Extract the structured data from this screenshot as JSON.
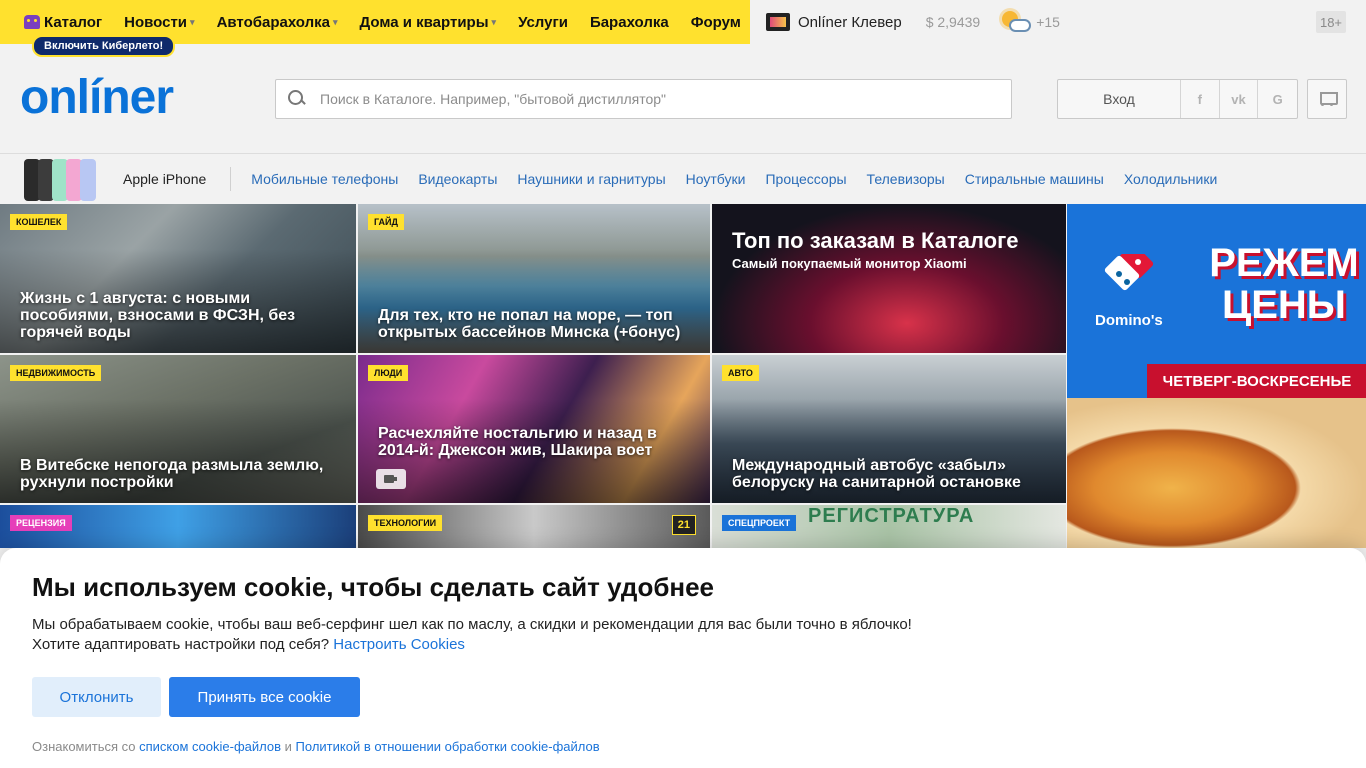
{
  "topnav": {
    "items": [
      {
        "label": "Каталог",
        "dropdown": false,
        "icon": "cyberleto-icon"
      },
      {
        "label": "Новости",
        "dropdown": true
      },
      {
        "label": "Автобарахолка",
        "dropdown": true
      },
      {
        "label": "Дома и квартиры",
        "dropdown": true
      },
      {
        "label": "Услуги",
        "dropdown": false
      },
      {
        "label": "Барахолка",
        "dropdown": false
      },
      {
        "label": "Форум",
        "dropdown": false
      }
    ],
    "cyber_button": "Включить Киберлето!",
    "accent_color": "#ffe12e"
  },
  "topright": {
    "klever": "Onlíner Клевер",
    "currency": "$ 2,9439",
    "temperature": "+15",
    "age_rating": "18+"
  },
  "header": {
    "logo": "onlíner",
    "search_placeholder": "Поиск в Каталоге. Например, \"бытовой дистиллятор\"",
    "search_value": "",
    "login": "Вход",
    "social": [
      "f",
      "vk",
      "G"
    ]
  },
  "catalog_strip": {
    "featured": "Apple iPhone",
    "links": [
      "Мобильные телефоны",
      "Видеокарты",
      "Наушники и гарнитуры",
      "Ноутбуки",
      "Процессоры",
      "Телевизоры",
      "Стиральные машины",
      "Холодильники"
    ]
  },
  "news": [
    {
      "tag": "Кошелек",
      "title": "Жизнь с 1 августа: с новыми пособиями, взносами в ФСЗН, без горячей воды"
    },
    {
      "tag": "Гайд",
      "title": "Для тех, кто не попал на море, — топ открытых бассейнов Минска (+бонус)"
    },
    {
      "promo_title": "Топ по заказам в Каталоге",
      "promo_sub": "Самый покупаемый монитор Xiaomi"
    },
    {
      "tag": "Недвижимость",
      "title": "В Витебске непогода размыла землю, рухнули постройки"
    },
    {
      "tag": "Люди",
      "title": "Расчехляйте ностальгию и назад в 2014-й: Джексон жив, Шакира воет"
    },
    {
      "tag": "Авто",
      "title": "Международный автобус «забыл» белоруску на санитарной остановке"
    },
    {
      "tag": "Рецензия"
    },
    {
      "tag": "Технологии",
      "comments": "21"
    },
    {
      "tag": "Спецпроект",
      "sign": "РЕГИСТРАТУРА"
    }
  ],
  "ad": {
    "brand": "Domino's",
    "headline": "РЕЖЕМ ЦЕНЫ",
    "ribbon": "ЧЕТВЕРГ-ВОСКРЕСЕНЬЕ"
  },
  "cookie": {
    "title": "Мы используем cookie, чтобы сделать сайт удобнее",
    "text_line1": "Мы обрабатываем cookie, чтобы ваш веб-серфинг шел как по маслу, а скидки и рекомендации для вас были точно в яблочко!",
    "text_line2": "Хотите адаптировать настройки под себя?",
    "settings_link": "Настроить Cookies",
    "decline": "Отклонить",
    "accept": "Принять все cookie",
    "foot_prefix": "Ознакомиться со",
    "foot_link1": "списком cookie-файлов",
    "foot_and": "и",
    "foot_link2": "Политикой в отношении обработки cookie-файлов"
  }
}
